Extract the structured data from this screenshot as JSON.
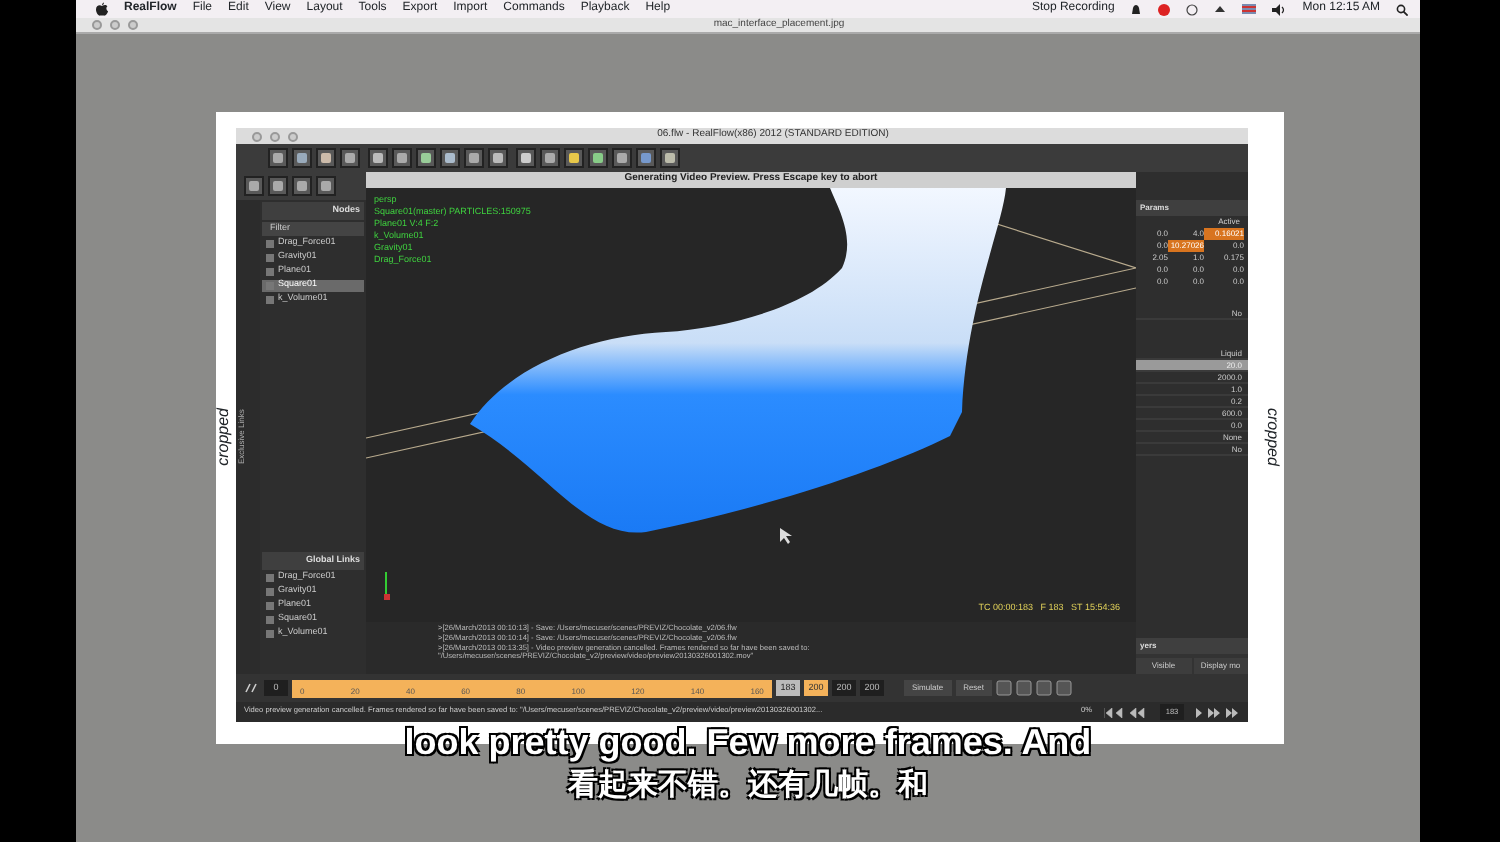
{
  "menubar": {
    "app": "RealFlow",
    "menus": [
      "File",
      "Edit",
      "View",
      "Layout",
      "Tools",
      "Export",
      "Import",
      "Commands",
      "Playback",
      "Help"
    ],
    "status_item": "Stop Recording",
    "clock": "Mon 12:15 AM"
  },
  "viewer": {
    "title": "mac_interface_placement.jpg",
    "crop_labels": [
      "cropped",
      "cropped"
    ]
  },
  "realflow": {
    "title": "06.flw - RealFlow(x86) 2012 (STANDARD EDITION)",
    "nodes": {
      "title": "Nodes",
      "filter": "Filter",
      "items": [
        {
          "label": "Drag_Force01",
          "selected": false
        },
        {
          "label": "Gravity01",
          "selected": false
        },
        {
          "label": "Plane01",
          "selected": false
        },
        {
          "label": "Square01",
          "selected": true
        },
        {
          "label": "k_Volume01",
          "selected": false
        }
      ]
    },
    "side_tab": "Exclusive Links",
    "global_links": {
      "title": "Global Links",
      "items": [
        "Drag_Force01",
        "Gravity01",
        "Plane01",
        "Square01",
        "k_Volume01"
      ]
    },
    "preview": {
      "title": "Generating Video Preview. Press Escape key to abort",
      "hud": [
        "persp",
        "Square01(master) PARTICLES:150975",
        "Plane01 V:4 F:2",
        "k_Volume01",
        "Gravity01",
        "Drag_Force01"
      ],
      "timecode": "TC 00:00:183   F 183   ST 15:54:36"
    },
    "log": [
      ">[26/March/2013 00:10:13] - Save: /Users/mecuser/scenes/PREVIZ/Chocolate_v2/06.flw",
      ">[26/March/2013 00:10:14] - Save: /Users/mecuser/scenes/PREVIZ/Chocolate_v2/06.flw",
      ">[26/March/2013 00:13:35] - Video preview generation cancelled. Frames rendered so far have been saved to:",
      "\"/Users/mecuser/scenes/PREVIZ/Chocolate_v2/preview/video/preview20130326001302.mov\""
    ],
    "params": {
      "title": "Params",
      "header": "Active",
      "grid": [
        [
          {
            "text": "0.0",
            "highlighted": false
          },
          {
            "text": "4.0",
            "highlighted": false
          },
          {
            "text": "0.16021",
            "highlighted": true
          }
        ],
        [
          {
            "text": "0.0",
            "highlighted": false
          },
          {
            "text": "10.27026",
            "highlighted": true
          },
          {
            "text": "0.0",
            "highlighted": false
          }
        ],
        [
          {
            "text": "2.05",
            "highlighted": false
          },
          {
            "text": "1.0",
            "highlighted": false
          },
          {
            "text": "0.175",
            "highlighted": false
          }
        ],
        [
          {
            "text": "0.0",
            "highlighted": false
          },
          {
            "text": "0.0",
            "highlighted": false
          },
          {
            "text": "0.0",
            "highlighted": false
          }
        ],
        [
          {
            "text": "0.0",
            "highlighted": false
          },
          {
            "text": "0.0",
            "highlighted": false
          },
          {
            "text": "0.0",
            "highlighted": false
          }
        ]
      ],
      "flag": "No",
      "values": [
        {
          "text": "Liquid",
          "selected": false
        },
        {
          "text": "20.0",
          "selected": true
        },
        {
          "text": "2000.0",
          "selected": false
        },
        {
          "text": "1.0",
          "selected": false
        },
        {
          "text": "0.2",
          "selected": false
        },
        {
          "text": "600.0",
          "selected": false
        },
        {
          "text": "0.0",
          "selected": false
        },
        {
          "text": "None",
          "selected": false
        },
        {
          "text": "No",
          "selected": false
        }
      ]
    },
    "layers": {
      "title": "yers",
      "buttons": [
        "Visible",
        "Display mo"
      ]
    },
    "timeline": {
      "start": "0",
      "ticks": [
        "0",
        "20",
        "40",
        "60",
        "80",
        "100",
        "120",
        "140",
        "160"
      ],
      "current": "183",
      "fields": [
        {
          "text": "200",
          "highlighted": true
        },
        {
          "text": "200",
          "highlighted": false
        },
        {
          "text": "200",
          "highlighted": false
        }
      ],
      "simulate": "Simulate",
      "reset": "Reset",
      "frame": "183",
      "progress": "0%"
    },
    "status": "Video preview generation cancelled. Frames rendered so far have been saved to: \"/Users/mecuser/scenes/PREVIZ/Chocolate_v2/preview/video/preview20130326001302..."
  },
  "subtitles": [
    "look pretty good. Few more frames. And",
    "看起来不错。还有几帧。和"
  ]
}
